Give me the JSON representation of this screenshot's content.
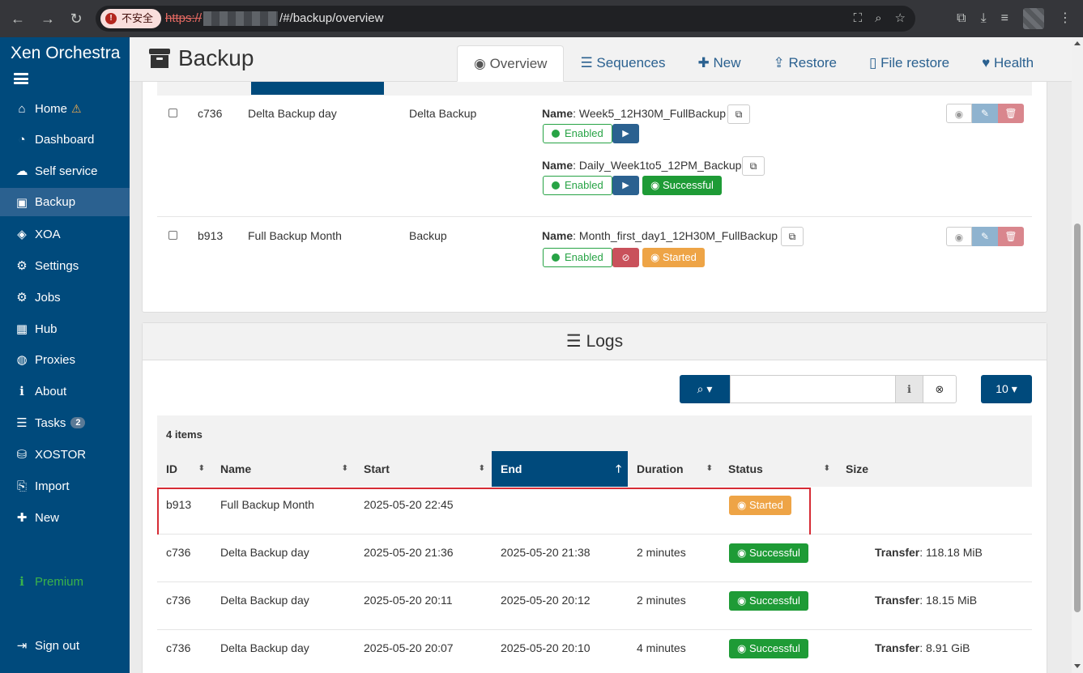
{
  "browser": {
    "security_label": "不安全",
    "url_scheme": "https://",
    "url_path": "/#/backup/overview"
  },
  "sidebar": {
    "brand": "Xen Orchestra",
    "items": [
      {
        "label": "Home",
        "icon": "home-icon"
      },
      {
        "label": "Dashboard",
        "icon": "dashboard-icon"
      },
      {
        "label": "Self service",
        "icon": "cloud-icon"
      },
      {
        "label": "Backup",
        "icon": "archive-icon"
      },
      {
        "label": "XOA",
        "icon": "cube-icon"
      },
      {
        "label": "Settings",
        "icon": "gear-icon"
      },
      {
        "label": "Jobs",
        "icon": "gears-icon"
      },
      {
        "label": "Hub",
        "icon": "cubes-icon"
      },
      {
        "label": "Proxies",
        "icon": "globe-icon"
      },
      {
        "label": "About",
        "icon": "info-icon"
      },
      {
        "label": "Tasks",
        "icon": "tasks-icon",
        "badge": "2"
      },
      {
        "label": "XOSTOR",
        "icon": "database-icon"
      },
      {
        "label": "Import",
        "icon": "import-icon"
      },
      {
        "label": "New",
        "icon": "plus-icon"
      }
    ],
    "premium": "Premium",
    "sign_out": "Sign out"
  },
  "header": {
    "title": "Backup",
    "tabs": [
      "Overview",
      "Sequences",
      "New",
      "Restore",
      "File restore",
      "Health"
    ]
  },
  "jobs": [
    {
      "id": "c736",
      "name": "Delta Backup day",
      "mode": "Delta Backup",
      "schedules": [
        {
          "name_label": "Name",
          "name": "Week5_12H30M_FullBackup",
          "state": "Enabled",
          "last": ""
        },
        {
          "name_label": "Name",
          "name": "Daily_Week1to5_12PM_Backup",
          "state": "Enabled",
          "last": "Successful"
        }
      ]
    },
    {
      "id": "b913",
      "name": "Full Backup Month",
      "mode": "Backup",
      "schedules": [
        {
          "name_label": "Name",
          "name": "Month_first_day1_12H30M_FullBackup",
          "state": "Enabled",
          "last": "Started"
        }
      ]
    }
  ],
  "logs": {
    "title": "Logs",
    "page_size": "10",
    "items_count": "4 items",
    "columns": [
      "ID",
      "Name",
      "Start",
      "End",
      "Duration",
      "Status",
      "Size"
    ],
    "rows": [
      {
        "id": "b913",
        "name": "Full Backup Month",
        "start": "2025-05-20 22:45",
        "end": "",
        "duration": "",
        "status": "Started",
        "size_label": "",
        "size": ""
      },
      {
        "id": "c736",
        "name": "Delta Backup day",
        "start": "2025-05-20 21:36",
        "end": "2025-05-20 21:38",
        "duration": "2 minutes",
        "status": "Successful",
        "size_label": "Transfer",
        "size": "118.18 MiB"
      },
      {
        "id": "c736",
        "name": "Delta Backup day",
        "start": "2025-05-20 20:11",
        "end": "2025-05-20 20:12",
        "duration": "2 minutes",
        "status": "Successful",
        "size_label": "Transfer",
        "size": "18.15 MiB"
      },
      {
        "id": "c736",
        "name": "Delta Backup day",
        "start": "2025-05-20 20:07",
        "end": "2025-05-20 20:10",
        "duration": "4 minutes",
        "status": "Successful",
        "size_label": "Transfer",
        "size": "8.91 GiB"
      }
    ]
  },
  "colors": {
    "sidebar": "#004a7c",
    "primary": "#2b6190",
    "success": "#1e9b36",
    "warning": "#eea446",
    "danger": "#c9515b",
    "highlight": "#d62c35"
  }
}
